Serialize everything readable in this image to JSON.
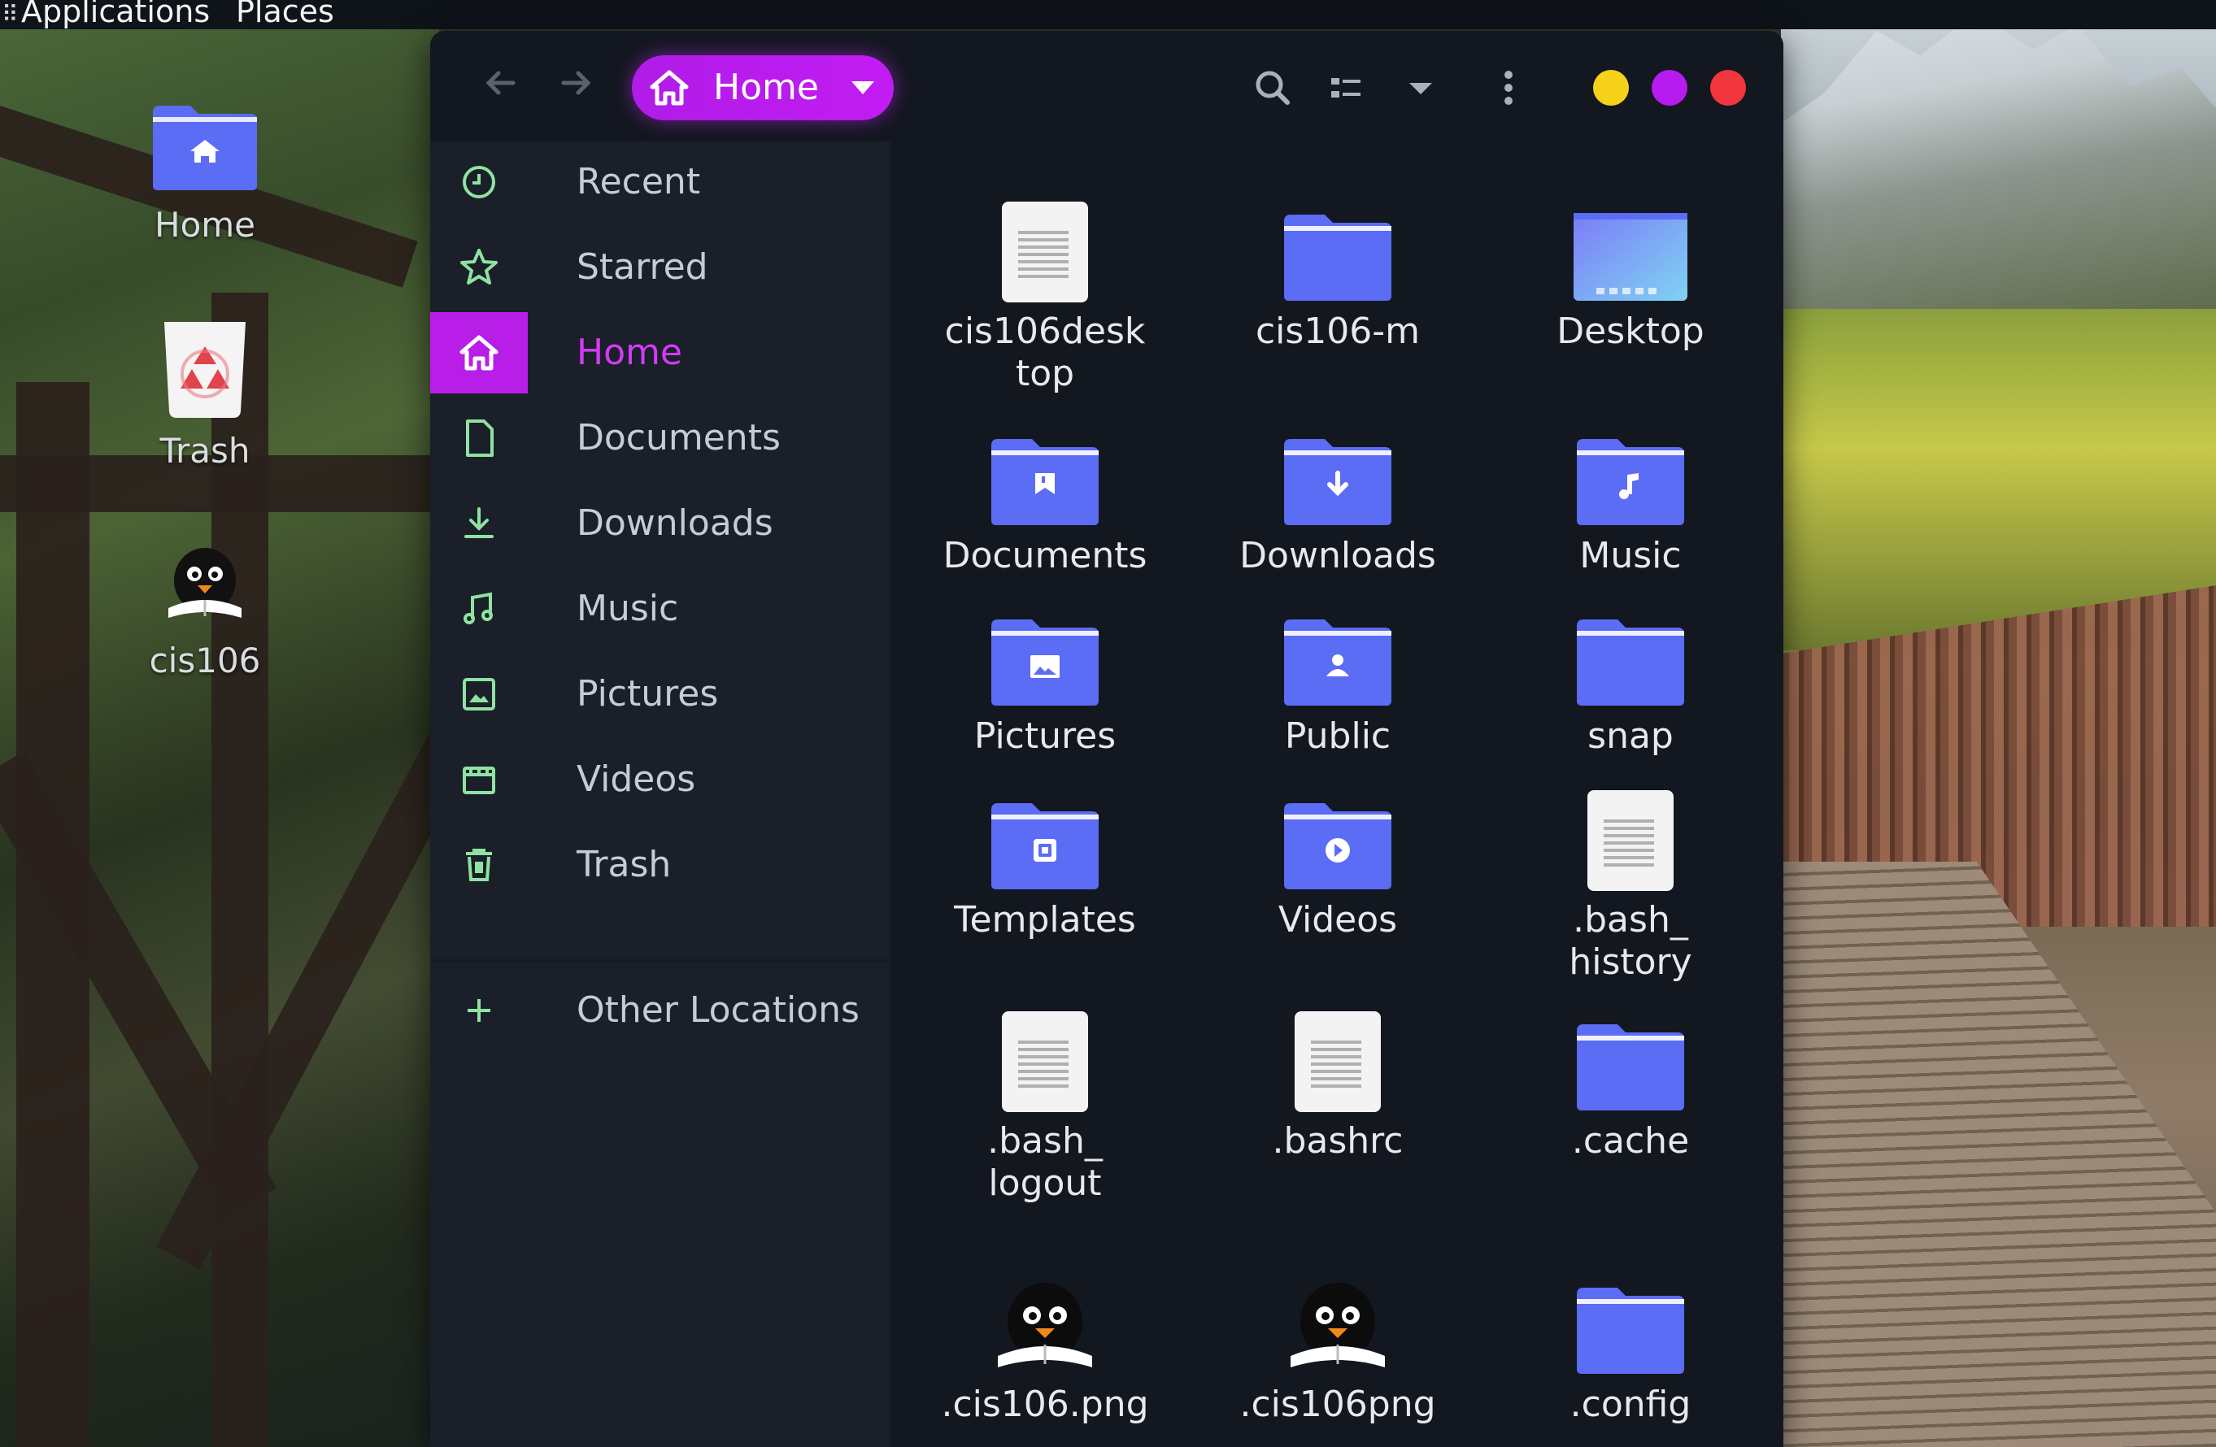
{
  "top_panel": {
    "applications": "Applications",
    "places": "Places"
  },
  "desktop": {
    "icons": [
      {
        "label": "Home",
        "icon": "home-folder-icon"
      },
      {
        "label": "Trash",
        "icon": "trash-icon"
      },
      {
        "label": "cis106",
        "icon": "penguin-icon"
      }
    ]
  },
  "window": {
    "path": {
      "label": "Home",
      "icon": "home-icon"
    },
    "controls": {
      "minimize_color": "#f7d21a",
      "maximize_color": "#b61bef",
      "close_color": "#f2363f"
    },
    "sidebar": {
      "items": [
        {
          "label": "Recent",
          "icon": "clock-icon"
        },
        {
          "label": "Starred",
          "icon": "star-icon"
        },
        {
          "label": "Home",
          "icon": "home-icon",
          "active": true
        },
        {
          "label": "Documents",
          "icon": "document-icon"
        },
        {
          "label": "Downloads",
          "icon": "download-icon"
        },
        {
          "label": "Music",
          "icon": "music-icon"
        },
        {
          "label": "Pictures",
          "icon": "picture-icon"
        },
        {
          "label": "Videos",
          "icon": "video-icon"
        },
        {
          "label": "Trash",
          "icon": "trash-icon"
        }
      ],
      "other_locations": {
        "label": "Other Locations",
        "icon": "plus-icon"
      }
    },
    "files": [
      {
        "line1": "cis106desk",
        "line2": "top",
        "type": "document"
      },
      {
        "line1": "cis106-m",
        "line2": "",
        "type": "folder"
      },
      {
        "line1": "Desktop",
        "line2": "",
        "type": "desktop-folder"
      },
      {
        "line1": "Documents",
        "line2": "",
        "type": "folder-documents"
      },
      {
        "line1": "Downloads",
        "line2": "",
        "type": "folder-downloads"
      },
      {
        "line1": "Music",
        "line2": "",
        "type": "folder-music"
      },
      {
        "line1": "Pictures",
        "line2": "",
        "type": "folder-pictures"
      },
      {
        "line1": "Public",
        "line2": "",
        "type": "folder-public"
      },
      {
        "line1": "snap",
        "line2": "",
        "type": "folder"
      },
      {
        "line1": "Templates",
        "line2": "",
        "type": "folder-templates"
      },
      {
        "line1": "Videos",
        "line2": "",
        "type": "folder-videos"
      },
      {
        "line1": ".bash_",
        "line2": "history",
        "type": "document"
      },
      {
        "line1": ".bash_",
        "line2": "logout",
        "type": "document"
      },
      {
        "line1": ".bashrc",
        "line2": "",
        "type": "document"
      },
      {
        "line1": ".cache",
        "line2": "",
        "type": "folder"
      },
      {
        "line1": ".cis106.png",
        "line2": "",
        "type": "image-penguin"
      },
      {
        "line1": ".cis106png",
        "line2": "",
        "type": "image-penguin"
      },
      {
        "line1": ".config",
        "line2": "",
        "type": "folder"
      }
    ]
  },
  "colors": {
    "accent": "#b81ee8",
    "folder": "#5b6cf5",
    "sidebar_icon": "#8fe3a0",
    "window_bg": "#13171f",
    "sidebar_bg": "#1a1f29"
  }
}
